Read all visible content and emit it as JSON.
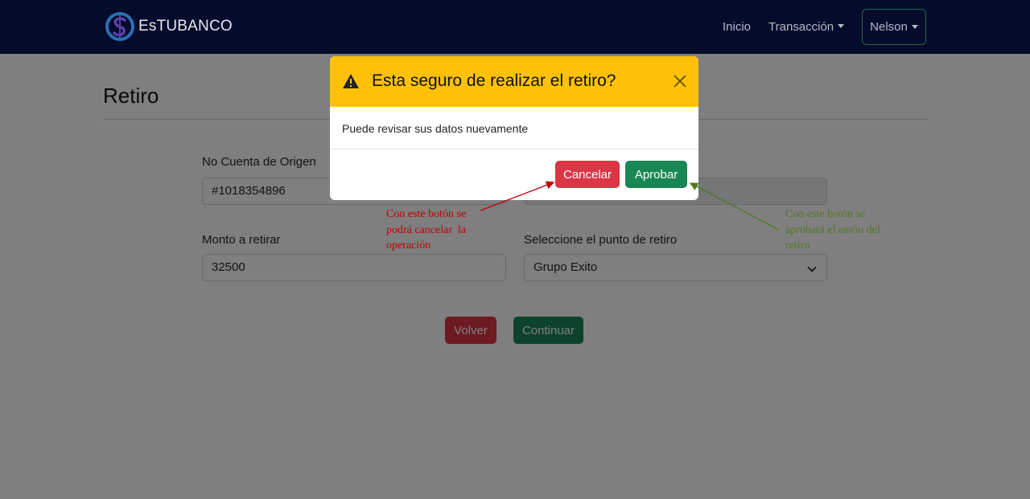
{
  "navbar": {
    "brand": "EsTUBANCO",
    "links": {
      "inicio": "Inicio",
      "transaccion": "Transacción"
    },
    "user": "Nelson"
  },
  "page": {
    "title": "Retiro",
    "form": {
      "origen_label": "No Cuenta de Origen",
      "origen_value": "#1018354896",
      "monto_label": "Monto a retirar",
      "monto_value": "32500",
      "punto_label": "Seleccione el punto de retiro",
      "punto_value": "Grupo Exito"
    },
    "buttons": {
      "volver": "Volver",
      "continuar": "Continuar"
    }
  },
  "modal": {
    "title": "Esta seguro de realizar el retiro?",
    "body": "Puede revisar sus datos nuevamente",
    "cancel": "Cancelar",
    "approve": "Aprobar",
    "header_color": "#ffc107"
  },
  "annotations": {
    "cancel_note": [
      "Con este botón se",
      "podrá cancelar  la",
      "operación"
    ],
    "approve_note": [
      "Con este botón se",
      "aprobará el envio del",
      "retiro"
    ]
  },
  "colors": {
    "navbar": "#040b2b",
    "danger": "#dc3545",
    "success": "#198754",
    "annotation_red": "#c00000",
    "annotation_green": "#4e7a1f"
  }
}
